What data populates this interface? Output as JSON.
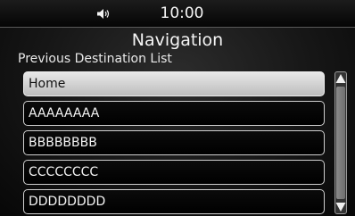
{
  "status": {
    "time": "10:00",
    "volume_icon": "speaker-icon"
  },
  "screen": {
    "title": "Navigation",
    "subtitle": "Previous Destination List"
  },
  "list": {
    "items": [
      {
        "label": "Home",
        "selected": true
      },
      {
        "label": "AAAAAAAA",
        "selected": false
      },
      {
        "label": "BBBBBBBB",
        "selected": false
      },
      {
        "label": "CCCCCCCC",
        "selected": false
      },
      {
        "label": "DDDDDDDD",
        "selected": false
      }
    ]
  },
  "scrollbar": {
    "up_icon": "triangle-up-icon",
    "down_icon": "triangle-down-icon"
  },
  "colors": {
    "selected_bg": "#d6d6d6",
    "border": "#cfcfcf",
    "background": "#111111"
  }
}
